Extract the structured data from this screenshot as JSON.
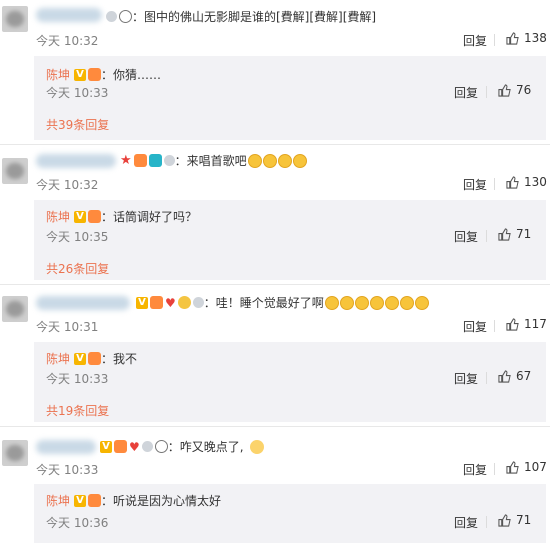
{
  "threads": [
    {
      "comment": {
        "text": "：图中的佛山无影脚是谁的[費解][費解][費解]",
        "time": "今天 10:32",
        "reply_label": "回复",
        "likes": "138"
      },
      "reply": {
        "author": "陈坤",
        "text": "：你猜……",
        "time": "今天 10:33",
        "reply_label": "回复",
        "likes": "76"
      },
      "more": "共39条回复"
    },
    {
      "comment": {
        "text": "：来唱首歌吧",
        "time": "今天 10:32",
        "reply_label": "回复",
        "likes": "130"
      },
      "reply": {
        "author": "陈坤",
        "text": "：话筒调好了吗？",
        "time": "今天 10:35",
        "reply_label": "回复",
        "likes": "71"
      },
      "more": "共26条回复"
    },
    {
      "comment": {
        "text": "：哇！睡个觉最好了啊",
        "time": "今天 10:31",
        "reply_label": "回复",
        "likes": "117"
      },
      "reply": {
        "author": "陈坤",
        "text": "：我不",
        "time": "今天 10:33",
        "reply_label": "回复",
        "likes": "67"
      },
      "more": "共19条回复"
    },
    {
      "comment": {
        "text": "：咋又晚点了,",
        "time": "今天 10:33",
        "reply_label": "回复",
        "likes": "107"
      },
      "reply": {
        "author": "陈坤",
        "text": "：听说是因为心情太好",
        "time": "今天 10:36",
        "reply_label": "回复",
        "likes": "71"
      }
    }
  ],
  "badges": {
    "v": "V"
  },
  "colors": {
    "name": "#eb7350",
    "reply_bg": "#f2f2f5",
    "muted": "#808080"
  },
  "icons": {
    "like": "thumbs-up-icon",
    "vip": "vip-badge-icon",
    "panda": "panda-icon"
  }
}
